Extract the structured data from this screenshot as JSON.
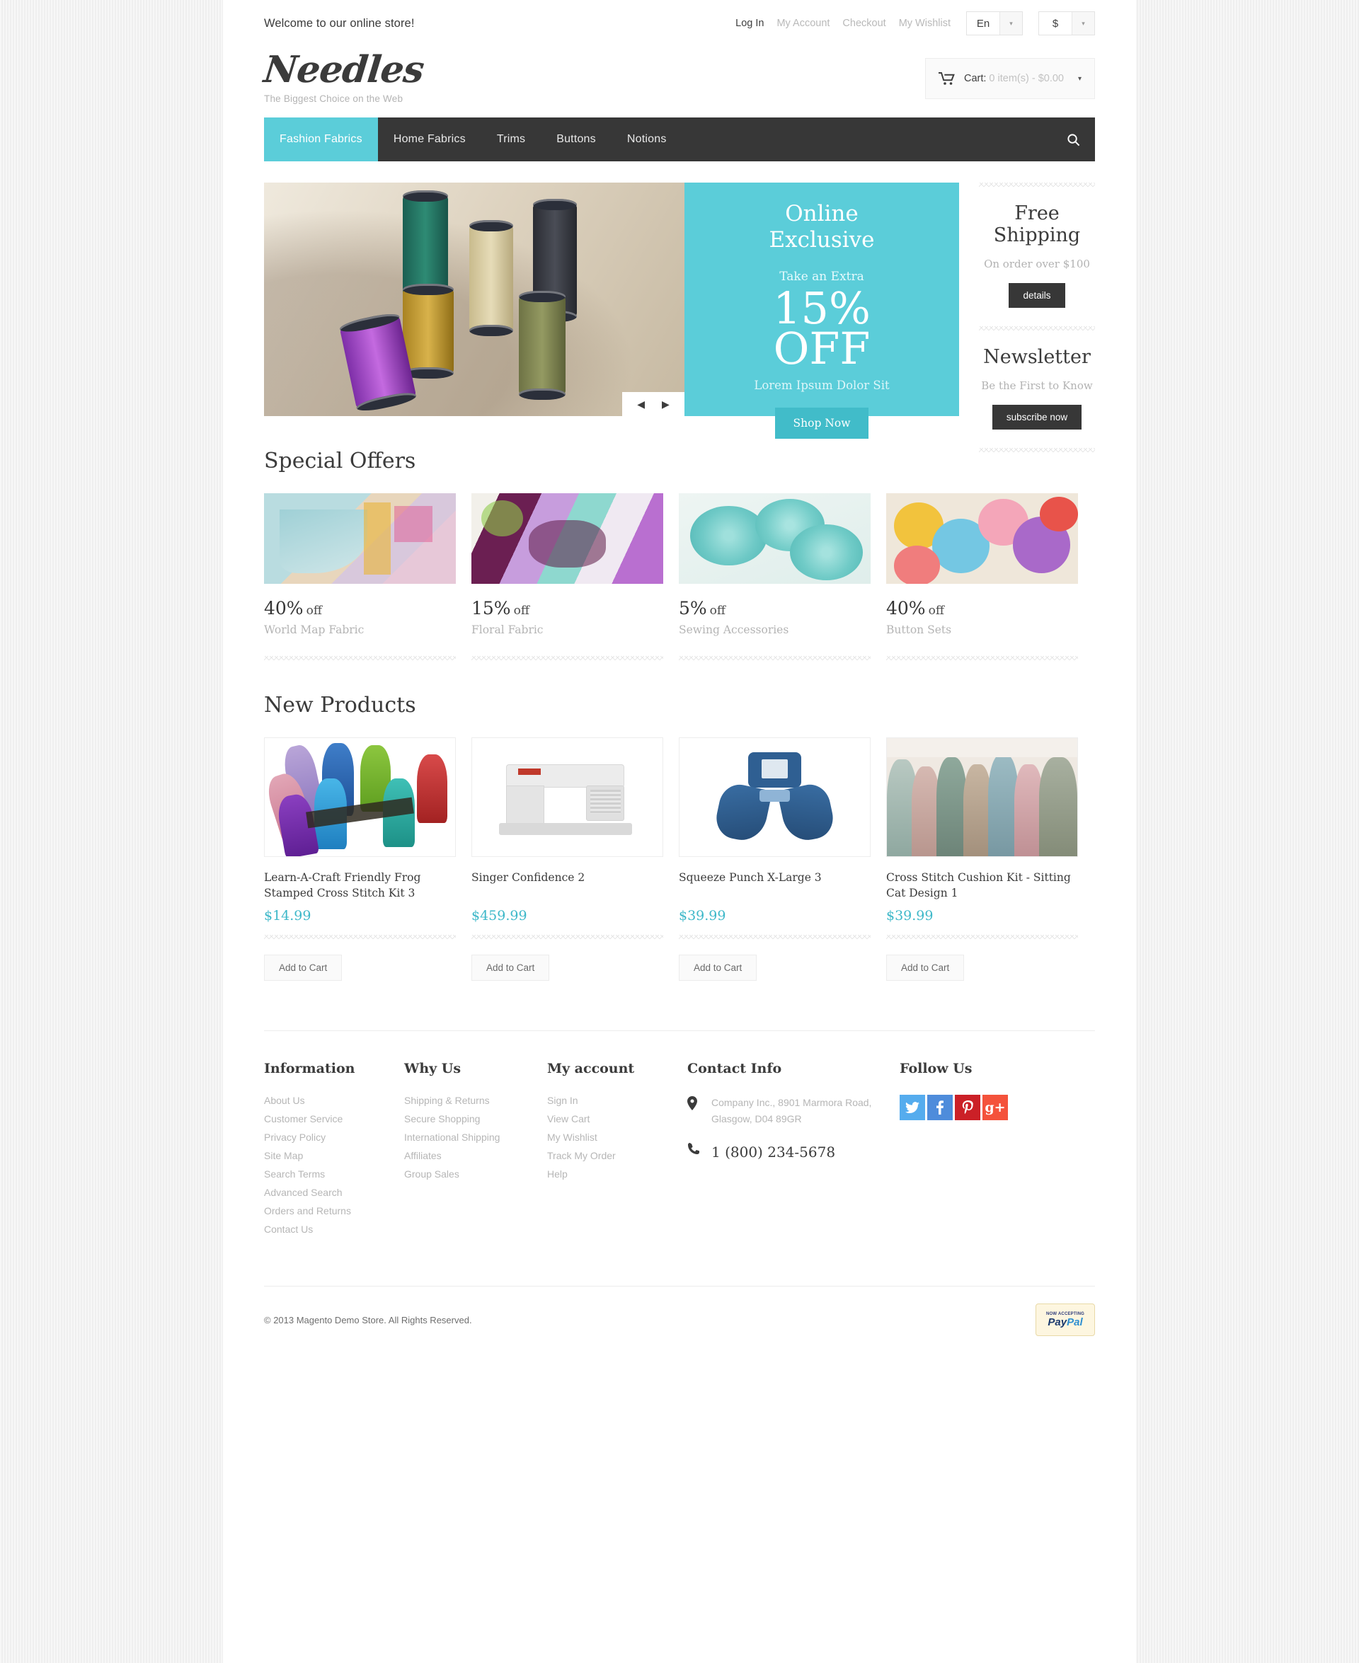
{
  "topbar": {
    "welcome": "Welcome to our online store!",
    "links": [
      {
        "label": "Log In",
        "strong": true
      },
      {
        "label": "My Account",
        "strong": false
      },
      {
        "label": "Checkout",
        "strong": false
      },
      {
        "label": "My Wishlist",
        "strong": false
      }
    ],
    "language": "En",
    "currency": "$",
    "caret": "▾"
  },
  "brand": {
    "name": "Needles",
    "tagline": "The Biggest Choice on the Web"
  },
  "cart": {
    "label": "Cart:",
    "value": "0 item(s) - $0.00",
    "icon": "shopping-cart-icon",
    "caret": "▾"
  },
  "nav": {
    "items": [
      {
        "label": "Fashion Fabrics",
        "active": true
      },
      {
        "label": "Home Fabrics",
        "active": false
      },
      {
        "label": "Trims",
        "active": false
      },
      {
        "label": "Buttons",
        "active": false
      },
      {
        "label": "Notions",
        "active": false
      }
    ],
    "search_icon": "search-icon"
  },
  "hero": {
    "slider": {
      "prev": "◀",
      "next": "▶",
      "alt": "Spools of colored thread on wood"
    },
    "promo": {
      "title": "Online\nExclusive",
      "title_line1": "Online",
      "title_line2": "Exclusive",
      "subtitle": "Take an Extra",
      "discount_line1": "15%",
      "discount_line2": "OFF",
      "caption": "Lorem Ipsum Dolor Sit",
      "cta": "Shop Now"
    }
  },
  "sidebar": {
    "blocks": [
      {
        "title_line1": "Free",
        "title_line2": "Shipping",
        "text": "On order over $100",
        "button": "details"
      },
      {
        "title_line1": "Newsletter",
        "title_line2": "",
        "text": "Be the First to Know",
        "button": "subscribe now"
      }
    ]
  },
  "special_offers": {
    "title": "Special Offers",
    "items": [
      {
        "pct": "40%",
        "off": "off",
        "name": "World Map Fabric",
        "image": "world-map-fabric"
      },
      {
        "pct": "15%",
        "off": "off",
        "name": "Floral Fabric",
        "image": "floral-fabric"
      },
      {
        "pct": "5%",
        "off": "off",
        "name": "Sewing Accessories",
        "image": "sewing-accessories"
      },
      {
        "pct": "40%",
        "off": "off",
        "name": "Button Sets",
        "image": "button-sets"
      }
    ]
  },
  "new_products": {
    "title": "New Products",
    "add_to_cart": "Add to Cart",
    "items": [
      {
        "name": "Learn-A-Craft Friendly Frog Stamped Cross Stitch Kit 3",
        "price": "$14.99",
        "image": "embroidery-floss"
      },
      {
        "name": "Singer Confidence 2",
        "price": "$459.99",
        "image": "sewing-machine"
      },
      {
        "name": "Squeeze Punch X-Large 3",
        "price": "$39.99",
        "image": "squeeze-punch"
      },
      {
        "name": "Cross Stitch Cushion Kit - Sitting Cat Design 1",
        "price": "$39.99",
        "image": "yarn-skeins"
      }
    ]
  },
  "footer": {
    "columns": [
      {
        "title": "Information",
        "links": [
          "About Us",
          "Customer Service",
          "Privacy Policy",
          "Site Map",
          "Search Terms",
          "Advanced Search",
          "Orders and Returns",
          "Contact Us"
        ]
      },
      {
        "title": "Why Us",
        "links": [
          "Shipping & Returns",
          "Secure Shopping",
          "International Shipping",
          "Affiliates",
          "Group Sales"
        ]
      },
      {
        "title": "My account",
        "links": [
          "Sign In",
          "View Cart",
          "My Wishlist",
          "Track My Order",
          "Help"
        ]
      }
    ],
    "contact": {
      "title": "Contact Info",
      "address": "Company Inc., 8901 Marmora Road, Glasgow, D04 89GR",
      "phone": "1 (800) 234-5678",
      "address_icon": "map-pin-icon",
      "phone_icon": "phone-icon"
    },
    "follow": {
      "title": "Follow Us",
      "socials": [
        {
          "name": "twitter-icon",
          "glyph": "🐦",
          "color": "#55ACEE"
        },
        {
          "name": "facebook-icon",
          "glyph": "f",
          "color": "#4E8CDB"
        },
        {
          "name": "pinterest-icon",
          "glyph": "P",
          "color": "#CB2027"
        },
        {
          "name": "googleplus-icon",
          "glyph": "g+",
          "color": "#F4523B"
        }
      ]
    },
    "copyright": "© 2013 Magento Demo Store. All Rights Reserved.",
    "paypal": {
      "line1": "NOW ACCEPTING",
      "line2a": "Pay",
      "line2b": "Pal"
    }
  },
  "colors": {
    "accent": "#5bcdd9",
    "price": "#3eb8c9",
    "dark": "#373737"
  }
}
